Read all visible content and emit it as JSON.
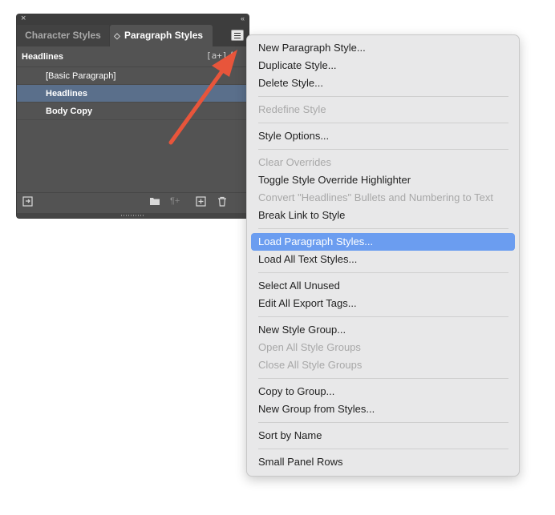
{
  "panel": {
    "close_glyph": "×",
    "collapse_glyph": "‹‹",
    "tabs": [
      {
        "label": "Character Styles",
        "active": false
      },
      {
        "label": "Paragraph Styles",
        "active": true
      }
    ],
    "sort_glyph": "◇",
    "current_style": "Headlines",
    "aa_glyph": "[a+]",
    "bolt_glyph": "ϟ",
    "styles": [
      {
        "label": "[Basic Paragraph]",
        "selected": false
      },
      {
        "label": "Headlines",
        "selected": true
      },
      {
        "label": "Body Copy",
        "selected": false
      }
    ],
    "footer_icons": [
      "load-styles-icon",
      "folder-icon",
      "clear-overrides-icon",
      "new-style-icon",
      "trash-icon"
    ]
  },
  "menu": {
    "items": [
      {
        "label": "New Paragraph Style...",
        "enabled": true
      },
      {
        "label": "Duplicate Style...",
        "enabled": true
      },
      {
        "label": "Delete Style...",
        "enabled": true
      },
      {
        "sep": true
      },
      {
        "label": "Redefine Style",
        "enabled": false
      },
      {
        "sep": true
      },
      {
        "label": "Style Options...",
        "enabled": true
      },
      {
        "sep": true
      },
      {
        "label": "Clear Overrides",
        "enabled": false
      },
      {
        "label": "Toggle Style Override Highlighter",
        "enabled": true
      },
      {
        "label": "Convert \"Headlines\" Bullets and Numbering to Text",
        "enabled": false
      },
      {
        "label": "Break Link to Style",
        "enabled": true
      },
      {
        "sep": true
      },
      {
        "label": "Load Paragraph Styles...",
        "enabled": true,
        "highlighted": true
      },
      {
        "label": "Load All Text Styles...",
        "enabled": true
      },
      {
        "sep": true
      },
      {
        "label": "Select All Unused",
        "enabled": true
      },
      {
        "label": "Edit All Export Tags...",
        "enabled": true
      },
      {
        "sep": true
      },
      {
        "label": "New Style Group...",
        "enabled": true
      },
      {
        "label": "Open All Style Groups",
        "enabled": false
      },
      {
        "label": "Close All Style Groups",
        "enabled": false
      },
      {
        "sep": true
      },
      {
        "label": "Copy to Group...",
        "enabled": true
      },
      {
        "label": "New Group from Styles...",
        "enabled": true
      },
      {
        "sep": true
      },
      {
        "label": "Sort by Name",
        "enabled": true
      },
      {
        "sep": true
      },
      {
        "label": "Small Panel Rows",
        "enabled": true
      }
    ]
  },
  "colors": {
    "highlight": "#6b9df0",
    "selected_row": "#5a6f8b",
    "annotation_arrow": "#e8553b"
  }
}
